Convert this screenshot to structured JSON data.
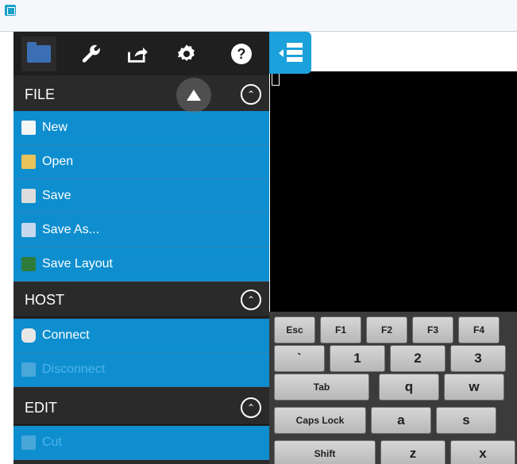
{
  "toolbar": {
    "tools": [
      {
        "name": "file-folder",
        "label": ""
      },
      {
        "name": "wrench",
        "label": ""
      },
      {
        "name": "share",
        "label": ""
      },
      {
        "name": "gear",
        "label": ""
      },
      {
        "name": "help",
        "label": "?"
      }
    ]
  },
  "sidebar": {
    "sections": [
      {
        "title": "FILE"
      },
      {
        "title": "HOST"
      },
      {
        "title": "EDIT"
      }
    ],
    "file_items": [
      "New",
      "Open",
      "Save",
      "Save As...",
      "Save Layout"
    ],
    "host_items": [
      "Connect",
      "Disconnect"
    ],
    "edit_items": [
      "Cut"
    ]
  },
  "keyboard": {
    "row1": [
      "Esc",
      "F1",
      "F2",
      "F3",
      "F4"
    ],
    "row2": [
      "`",
      "1",
      "2",
      "3"
    ],
    "row3": [
      "Tab",
      "q",
      "w"
    ],
    "row4": [
      "Caps Lock",
      "a",
      "s"
    ],
    "row5": [
      "Shift",
      "z",
      "x"
    ]
  },
  "colors": {
    "menu_blue": "#0e8ecf",
    "accent_blue": "#1ba1db",
    "section_dark": "#2a2a2a"
  }
}
